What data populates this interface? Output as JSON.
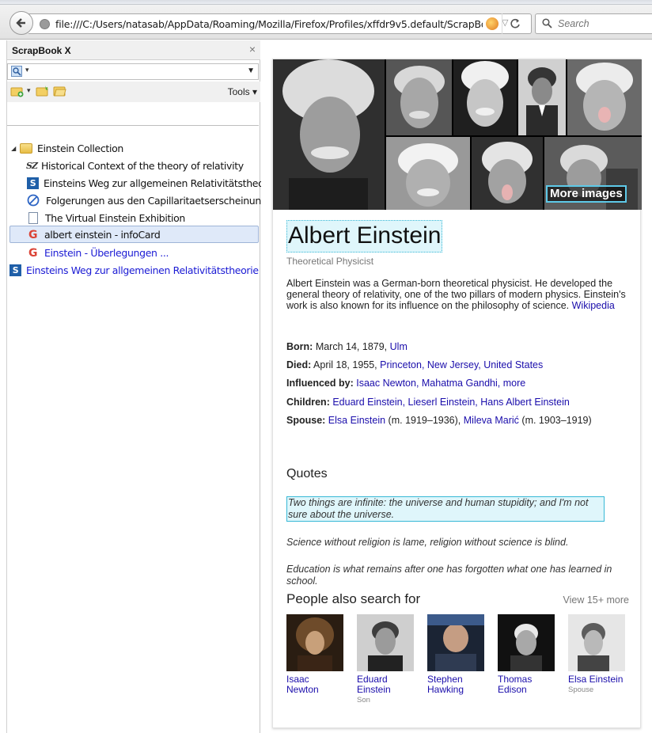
{
  "browser": {
    "url": "file:///C:/Users/natasab/AppData/Roaming/Mozilla/Firefox/Profiles/xffdr9v5.default/ScrapBook/da",
    "search_placeholder": "Search",
    "reload_icon": "reload-icon"
  },
  "sidebar": {
    "title": "ScrapBook X",
    "close": "×",
    "tools_label": "Tools",
    "tree": [
      {
        "label": "Einstein Collection",
        "icon": "folder-icon",
        "type": "folder"
      },
      {
        "label": "Historical Context of the theory of relativity",
        "icon": "sz-icon",
        "type": "item"
      },
      {
        "label": "Einsteins Weg zur allgemeinen Relativitätstheorie",
        "icon": "s-icon",
        "type": "item"
      },
      {
        "label": "Folgerungen aus den Capillaritaetserscheinungen",
        "icon": "no-entry-icon",
        "type": "item"
      },
      {
        "label": "The Virtual Einstein Exhibition",
        "icon": "document-icon",
        "type": "item"
      },
      {
        "label": "albert einstein - infoCard",
        "icon": "google-icon",
        "type": "item",
        "selected": true
      },
      {
        "label": "Einstein - Überlegungen ...",
        "icon": "google-icon",
        "type": "link"
      },
      {
        "label": "Einsteins Weg zur allgemeinen Relativitätstheorie",
        "icon": "s-icon",
        "type": "link"
      }
    ]
  },
  "infocard": {
    "more_images": "More images",
    "title": "Albert Einstein",
    "subtitle": "Theoretical Physicist",
    "description": "Albert Einstein was a German-born theoretical physicist. He developed the general theory of relativity, one of the two pillars of modern physics. Einstein's work is also known for its influence on the philosophy of science.",
    "description_link": "Wikipedia",
    "facts": {
      "born_label": "Born:",
      "born_text": "March 14, 1879,",
      "born_link": "Ulm",
      "died_label": "Died:",
      "died_text": "April 18, 1955,",
      "died_link": "Princeton, New Jersey, United States",
      "influenced_label": "Influenced by:",
      "influenced_link": "Isaac Newton, Mahatma Gandhi, more",
      "children_label": "Children:",
      "children_link": "Eduard Einstein, Lieserl Einstein, Hans Albert Einstein",
      "spouse_label": "Spouse:",
      "spouse_link1": "Elsa Einstein",
      "spouse_text1": "(m. 1919–1936),",
      "spouse_link2": "Mileva Marić",
      "spouse_text2": "(m. 1903–1919)"
    },
    "quotes_heading": "Quotes",
    "quotes": [
      "Two things are infinite: the universe and human stupidity; and I'm not sure about the universe.",
      "Science without religion is lame, religion without science is blind.",
      "Education is what remains after one has forgotten what one has learned in school."
    ],
    "people_heading": "People also search for",
    "people_view_more": "View 15+ more",
    "people": [
      {
        "name": "Isaac Newton",
        "role": ""
      },
      {
        "name": "Eduard Einstein",
        "role": "Son"
      },
      {
        "name": "Stephen Hawking",
        "role": ""
      },
      {
        "name": "Thomas Edison",
        "role": ""
      },
      {
        "name": "Elsa Einstein",
        "role": "Spouse"
      }
    ]
  }
}
